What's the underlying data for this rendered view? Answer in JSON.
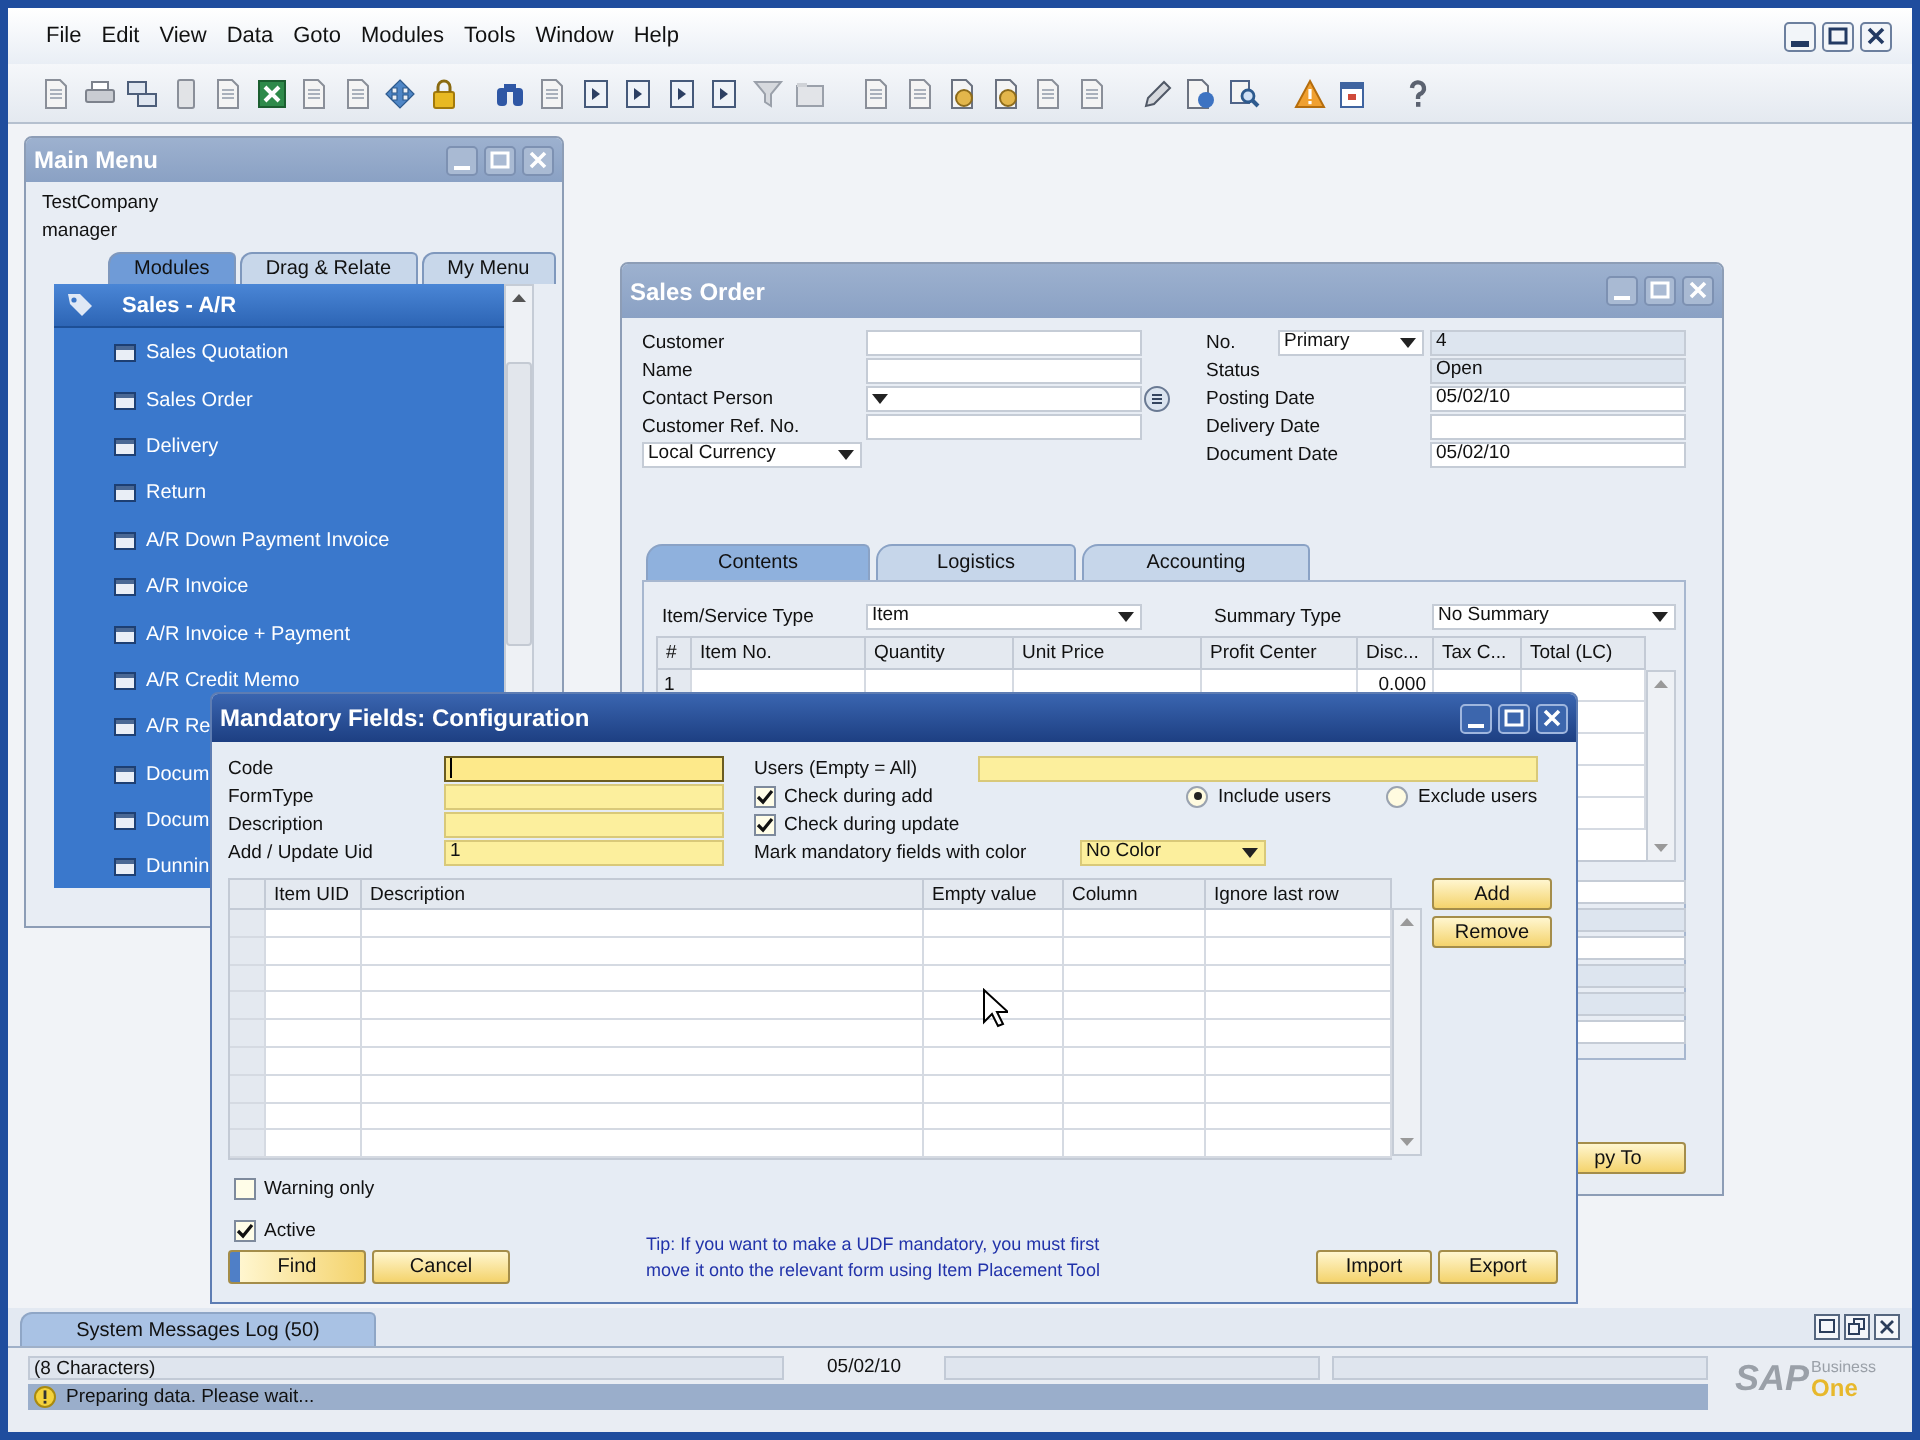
{
  "menu": [
    "File",
    "Edit",
    "View",
    "Data",
    "Goto",
    "Modules",
    "Tools",
    "Window",
    "Help"
  ],
  "main_menu": {
    "title": "Main Menu",
    "company": "TestCompany",
    "user": "manager",
    "tabs": [
      {
        "label": "Modules",
        "selected": true
      },
      {
        "label": "Drag & Relate",
        "selected": false
      },
      {
        "label": "My Menu",
        "selected": false
      }
    ],
    "section": "Sales - A/R",
    "items": [
      "Sales Quotation",
      "Sales Order",
      "Delivery",
      "Return",
      "A/R Down Payment Invoice",
      "A/R Invoice",
      "A/R Invoice + Payment",
      "A/R Credit Memo",
      "A/R Re",
      "Docum",
      "Docum",
      "Dunnin"
    ]
  },
  "sales_order": {
    "title": "Sales Order",
    "left_fields": [
      {
        "label": "Customer",
        "kind": "text"
      },
      {
        "label": "Name",
        "kind": "text"
      },
      {
        "label": "Contact Person",
        "kind": "dropdown"
      },
      {
        "label": "Customer Ref. No.",
        "kind": "text"
      }
    ],
    "currency": "Local Currency",
    "number": {
      "label": "No.",
      "series": "Primary",
      "value": "4"
    },
    "right_fields": [
      {
        "label": "Status",
        "value": "Open",
        "editable": false
      },
      {
        "label": "Posting Date",
        "value": "05/02/10",
        "editable": true
      },
      {
        "label": "Delivery Date",
        "editable": true
      },
      {
        "label": "Document Date",
        "value": "05/02/10",
        "editable": true
      }
    ],
    "tabs": [
      {
        "label": "Contents",
        "selected": true
      },
      {
        "label": "Logistics",
        "selected": false
      },
      {
        "label": "Accounting",
        "selected": false
      }
    ],
    "item_type": {
      "label": "Item/Service Type",
      "value": "Item"
    },
    "summary_type": {
      "label": "Summary Type",
      "value": "No Summary"
    },
    "columns": [
      "#",
      "Item No.",
      "Quantity",
      "Unit Price",
      "Profit Center",
      "Disc...",
      "Tax C...",
      "Total (LC)"
    ],
    "rows": [
      [
        "1",
        "",
        "",
        "",
        "",
        "0.000",
        "",
        ""
      ]
    ],
    "footer_fields": [
      {
        "editable": true
      },
      {
        "editable": false
      },
      {
        "editable": true
      },
      {
        "editable": false
      },
      {
        "editable": false
      },
      {
        "editable": true
      }
    ],
    "copy_button": "py To"
  },
  "dialog": {
    "title": "Mandatory Fields: Configuration",
    "fields": [
      {
        "label": "Code",
        "focused": true
      },
      {
        "label": "FormType",
        "focused": false
      },
      {
        "label": "Description",
        "focused": false
      },
      {
        "label": "Add / Update Uid",
        "value": "1",
        "focused": false
      }
    ],
    "users": {
      "label": "Users (Empty = All)"
    },
    "checks": [
      {
        "label": "Check during add",
        "checked": true
      },
      {
        "label": "Check during update",
        "checked": true
      }
    ],
    "radios": [
      {
        "label": "Include users",
        "selected": true
      },
      {
        "label": "Exclude users",
        "selected": false
      }
    ],
    "color": {
      "label": "Mark mandatory fields with color",
      "value": "No Color"
    },
    "columns": [
      "Item UID",
      "Description",
      "Empty value",
      "Column",
      "Ignore last row"
    ],
    "side_buttons": [
      "Add",
      "Remove"
    ],
    "options": [
      {
        "label": "Warning only",
        "checked": false
      },
      {
        "label": "Active",
        "checked": true
      }
    ],
    "buttons": [
      "Find",
      "Cancel"
    ],
    "tip": [
      "Tip: If you want to make a UDF mandatory, you must first",
      "move it onto the relevant form using Item Placement Tool"
    ],
    "right_buttons": [
      "Import",
      "Export"
    ]
  },
  "messages_tab": "System Messages Log (50)",
  "status": {
    "characters": "(8 Characters)",
    "date": "05/02/10",
    "message": "Preparing data. Please wait..."
  },
  "logo": {
    "brand": "SAP",
    "line1": "Business",
    "line2": "One"
  }
}
